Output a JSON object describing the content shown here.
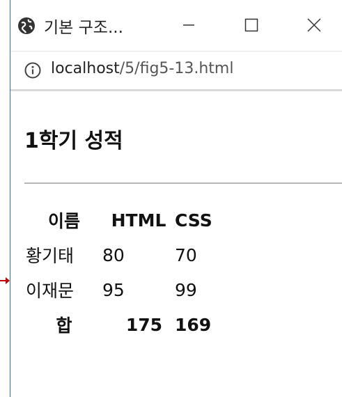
{
  "window": {
    "title": "기본 구조...",
    "controls": {
      "minimize": "—",
      "maximize": "☐",
      "close": "✕"
    }
  },
  "address_bar": {
    "host": "localhost",
    "path": "/5/fig5-13.html"
  },
  "page": {
    "heading": "1학기 성적",
    "table": {
      "headers": [
        "이름",
        "HTML",
        "CSS"
      ],
      "rows": [
        [
          "황기태",
          "80",
          "70"
        ],
        [
          "이재문",
          "95",
          "99"
        ]
      ],
      "footer": [
        "합",
        "175",
        "169"
      ]
    }
  },
  "colors": {
    "window_border": "#2b6cc4",
    "arrow": "#c00000"
  },
  "icons": [
    "globe-icon",
    "info-icon",
    "minimize-icon",
    "maximize-icon",
    "close-icon",
    "arrow-icon"
  ]
}
